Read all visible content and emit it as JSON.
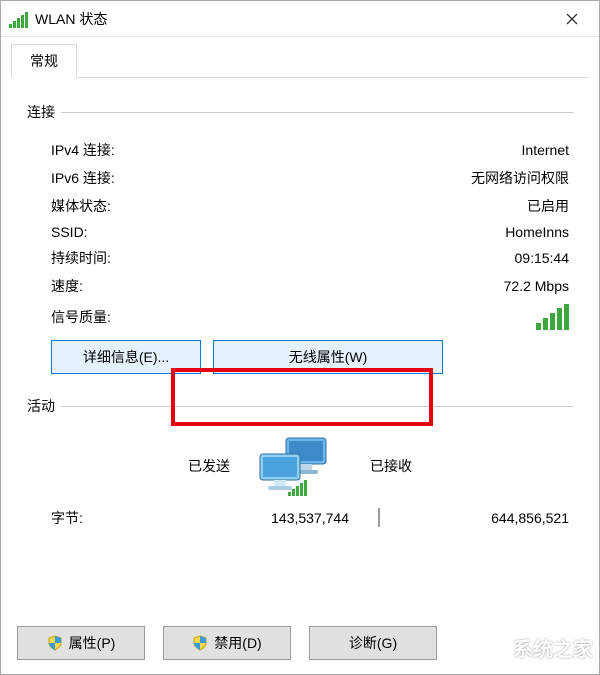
{
  "window": {
    "title": "WLAN 状态"
  },
  "tabs": {
    "general": "常规"
  },
  "connection": {
    "legend": "连接",
    "ipv4_label": "IPv4 连接:",
    "ipv4_value": "Internet",
    "ipv6_label": "IPv6 连接:",
    "ipv6_value": "无网络访问权限",
    "media_label": "媒体状态:",
    "media_value": "已启用",
    "ssid_label": "SSID:",
    "ssid_value": "HomeInns",
    "duration_label": "持续时间:",
    "duration_value": "09:15:44",
    "speed_label": "速度:",
    "speed_value": "72.2 Mbps",
    "signal_label": "信号质量:"
  },
  "buttons": {
    "details": "详细信息(E)...",
    "wireless_props": "无线属性(W)",
    "properties": "属性(P)",
    "disable": "禁用(D)",
    "diagnose": "诊断(G)"
  },
  "activity": {
    "legend": "活动",
    "sent_label": "已发送",
    "received_label": "已接收",
    "bytes_label": "字节:",
    "bytes_sent": "143,537,744",
    "bytes_received": "644,856,521"
  },
  "watermark": "系统之家"
}
